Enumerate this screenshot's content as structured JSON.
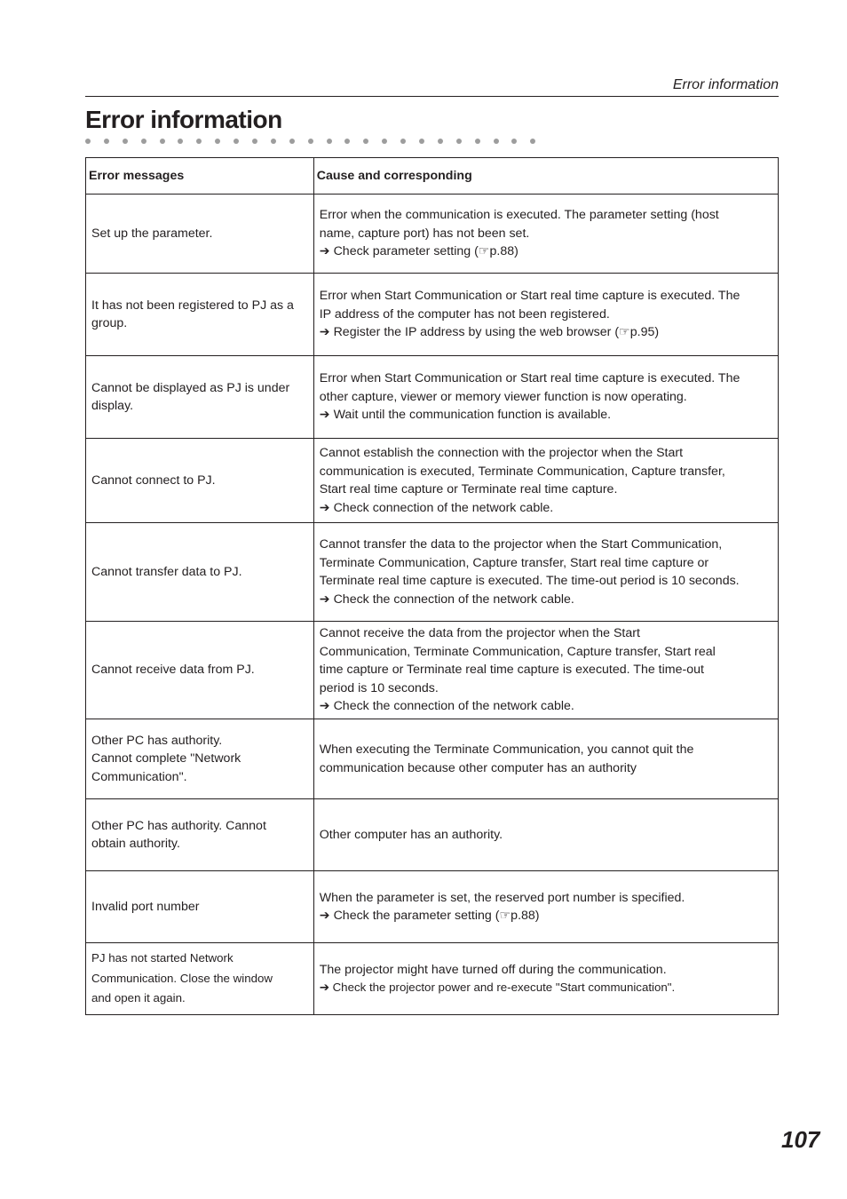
{
  "running_head": "Error information",
  "title": "Error information",
  "table": {
    "headers": [
      "Error messages",
      "Cause and corresponding"
    ],
    "rows": [
      {
        "message": [
          "Set up the parameter."
        ],
        "cause": [
          "Error when the communication is executed. The parameter setting (host",
          "name, capture port) has not been set.",
          "➔ Check parameter setting (☞p.88)"
        ]
      },
      {
        "message": [
          "It has not been registered to PJ as a",
          "group."
        ],
        "cause": [
          "Error when Start Communication or Start real time capture is executed. The",
          "IP address of the computer has not been registered.",
          "➔ Register the IP address by using the web browser (☞p.95)"
        ]
      },
      {
        "message": [
          "Cannot be displayed as PJ is under",
          "display."
        ],
        "cause": [
          "Error when Start Communication or Start real time capture is executed. The",
          "other capture, viewer or memory viewer function is now operating.",
          "➔ Wait until the communication function is available."
        ]
      },
      {
        "message": [
          "Cannot connect to PJ."
        ],
        "cause": [
          "Cannot establish the connection with the projector when the Start",
          "communication is executed, Terminate Communication, Capture transfer,",
          "Start real time capture or Terminate real time capture.",
          "➔ Check connection of the network cable."
        ]
      },
      {
        "message": [
          "Cannot transfer data to PJ."
        ],
        "cause": [
          "Cannot transfer the data to the projector when the Start Communication,",
          "Terminate Communication, Capture transfer, Start real time capture or",
          "Terminate real time capture is executed. The time-out period is 10 seconds.",
          "➔ Check the connection of the network cable."
        ]
      },
      {
        "message": [
          "Cannot receive data from PJ."
        ],
        "cause": [
          "Cannot receive the data from the projector when the Start",
          "Communication, Terminate Communication, Capture transfer, Start real",
          "time capture or Terminate real time capture is executed.  The time-out",
          "period is 10 seconds.",
          "➔ Check the connection of the network cable."
        ]
      },
      {
        "message": [
          "Other PC has authority.",
          "Cannot complete \"Network",
          "Communication\"."
        ],
        "cause": [
          "When executing the Terminate Communication, you cannot quit the",
          "communication because other computer has an authority"
        ]
      },
      {
        "message": [
          "Other PC has authority. Cannot",
          "obtain authority."
        ],
        "cause": [
          "Other computer has an authority."
        ]
      },
      {
        "message": [
          "Invalid port number"
        ],
        "cause": [
          "When the parameter is set, the reserved port number is specified.",
          "➔ Check the parameter setting (☞p.88)"
        ]
      },
      {
        "message": [
          "PJ has not started Network",
          "Communication. Close the window",
          "and open it again."
        ],
        "cause": [
          "The projector might have turned off during the communication.",
          "➔ Check the projector power and re-execute \"Start communication\"."
        ]
      }
    ]
  },
  "page_number": "107"
}
